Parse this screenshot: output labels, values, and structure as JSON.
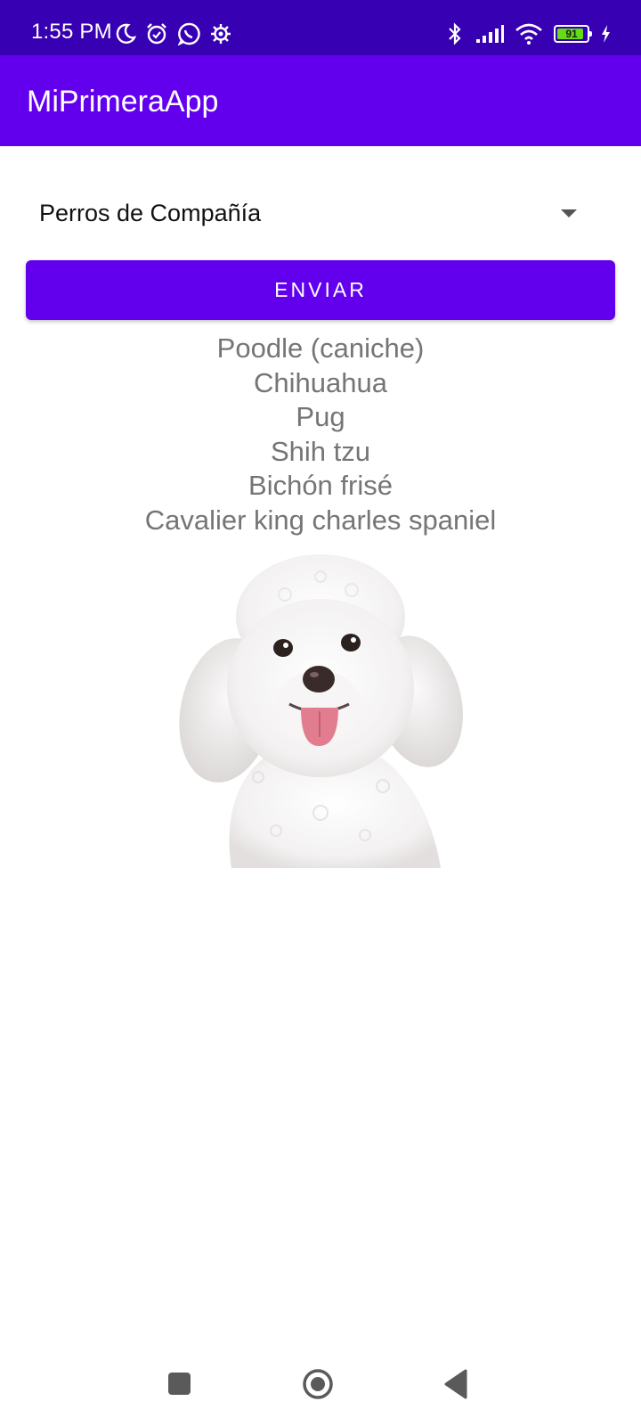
{
  "status_bar": {
    "time": "1:55 PM",
    "left_icons": [
      "moon-icon",
      "alarm-icon",
      "whatsapp-icon",
      "settings-icon"
    ],
    "right_icons": [
      "bluetooth-icon",
      "signal-icon",
      "wifi-icon",
      "battery-icon",
      "charging-icon"
    ],
    "battery_level": "91",
    "battery_fraction": 0.91,
    "background_color": "#3700B3"
  },
  "app_bar": {
    "title": "MiPrimeraApp",
    "background_color": "#6200EE"
  },
  "spinner": {
    "selected_value": "Perros de Compañía"
  },
  "send_button": {
    "label": "ENVIAR",
    "color": "#6200EE"
  },
  "breed_list": {
    "items": [
      "Poodle (caniche)",
      "Chihuahua",
      "Pug",
      "Shih tzu",
      "Bichón frisé",
      "Cavalier king charles spaniel"
    ],
    "text_color": "#757575"
  },
  "nav_bar": {
    "buttons": [
      "recents-icon",
      "home-icon",
      "back-icon"
    ]
  }
}
